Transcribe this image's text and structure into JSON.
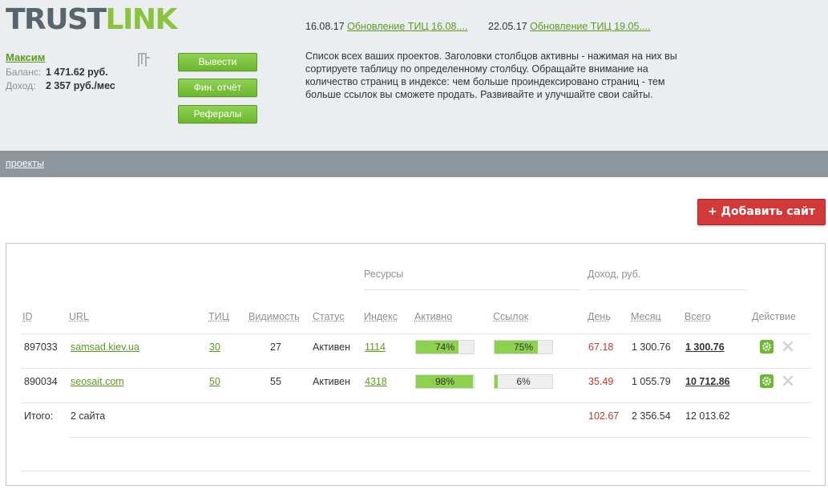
{
  "logo": {
    "part1": "TRUST",
    "part2": "LINK"
  },
  "user": {
    "name": "Максим",
    "balance_label": "Баланс:",
    "balance_value": "1 471.62  руб.",
    "income_label": "Доход:",
    "income_value": "2 357 руб./мес"
  },
  "buttons": {
    "withdraw": "Вывести",
    "finance": "Фин. отчёт",
    "referrals": "Рефералы"
  },
  "news": [
    {
      "date": "16.08.17",
      "link": "Обновление ТИЦ 16.08...."
    },
    {
      "date": "22.05.17",
      "link": "Обновление ТИЦ 19.05...."
    }
  ],
  "info_text": "Список всех ваших проектов. Заголовки столбцов активны - нажимая на них вы сортируете таблицу по определенному столбцу. Обращайте внимание на количество страниц в индексе: чем больше проиндексировано страниц - тем больше ссылок вы сможете продать. Развивайте и улучшайте свои сайты.",
  "nav": {
    "projects": "проекты"
  },
  "add_site": "+ Добавить сайт",
  "table": {
    "group_resources": "Ресурсы",
    "group_income": "Доход,  руб.",
    "headers": {
      "id": "ID",
      "url": "URL",
      "tic": "ТИЦ",
      "visibility": "Видимость",
      "status": "Статус",
      "index": "Индекс",
      "active": "Активно",
      "links": "Ссылок",
      "day": "День",
      "month": "Месяц",
      "total": "Всего",
      "action": "Действие"
    },
    "rows": [
      {
        "id": "897033",
        "url": "samsad.kiev.ua",
        "tic": "30",
        "visibility": "27",
        "status": "Активен",
        "index": "1114",
        "active": "74%",
        "active_frac": 0.74,
        "links": "75%",
        "links_frac": 0.75,
        "day": "67.18",
        "month": "1 300.76",
        "total": "1 300.76"
      },
      {
        "id": "890034",
        "url": "seosait.com",
        "tic": "50",
        "visibility": "55",
        "status": "Активен",
        "index": "4318",
        "active": "98%",
        "active_frac": 0.98,
        "links": "6%",
        "links_frac": 0.06,
        "day": "35.49",
        "month": "1 055.79",
        "total": "10 712.86"
      }
    ],
    "totals": {
      "label": "Итого:",
      "count": "2 сайта",
      "day": "102.67",
      "month": "2 356.54",
      "total": "12 013.62"
    }
  },
  "colors": {
    "green": "#5b9b1d",
    "bar_fill": "#8ed14f",
    "red_button": "#d23a3a",
    "nav_bar": "#8d969c",
    "header_bg": "#ebeef0"
  },
  "icons": {
    "logout": "logout-icon",
    "settings": "gear-icon",
    "delete": "close-icon"
  }
}
